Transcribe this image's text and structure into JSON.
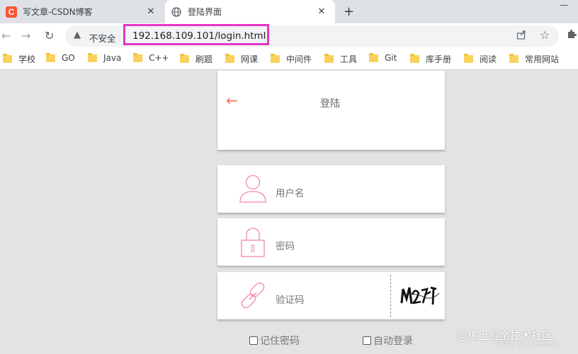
{
  "browser": {
    "tabs": [
      {
        "title": "写文章-CSDN博客",
        "icon": "csdn-icon",
        "icon_text": "C",
        "close": "✕"
      },
      {
        "title": "登陆界面",
        "icon": "globe-icon",
        "close": "✕"
      }
    ],
    "new_tab": "+",
    "minimize": "—",
    "security_label": "不安全",
    "url": "192.168.109.101/login.html",
    "highlight_color": "#e535c8"
  },
  "bookmarks": [
    "学校",
    "GO",
    "Java",
    "C++",
    "刷题",
    "网课",
    "中间件",
    "工具",
    "Git",
    "库手册",
    "阅读",
    "常用网站"
  ],
  "page": {
    "title": "登陆",
    "back_icon": "←",
    "username_label": "用户名",
    "password_label": "密码",
    "captcha_label": "验证码",
    "remember_label": "记住密码",
    "autologin_label": "自动登录",
    "accent_color": "#f07a52",
    "icon_color": "#f08aa0"
  },
  "watermark": {
    "line1": "@稀土掘金技术社区",
    "line2": "CSDN @cheems~"
  }
}
